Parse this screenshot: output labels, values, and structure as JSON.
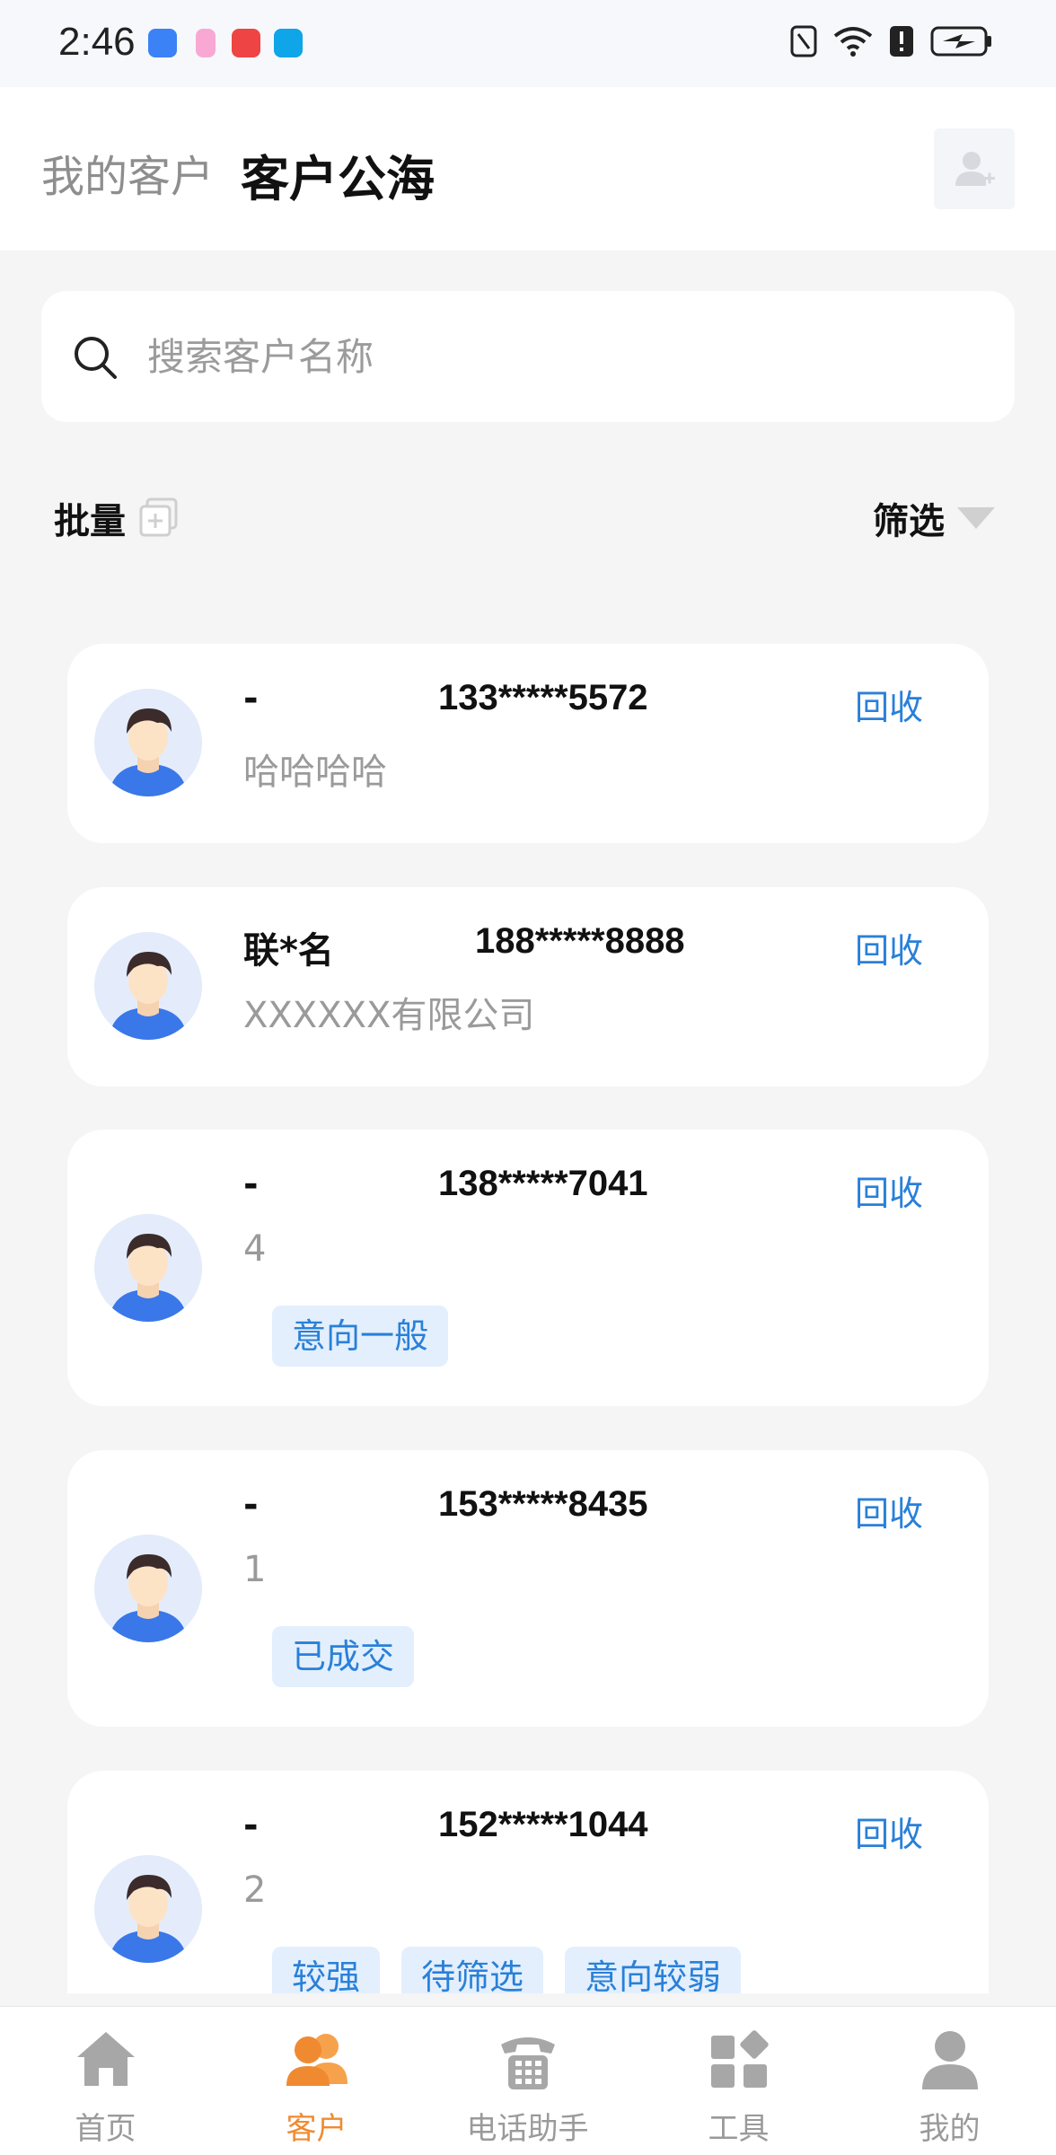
{
  "status_bar": {
    "time": "2:46"
  },
  "header": {
    "tab_mine": "我的客户",
    "tab_public": "客户公海"
  },
  "search": {
    "placeholder": "搜索客户名称"
  },
  "toolbar": {
    "batch_label": "批量",
    "filter_label": "筛选"
  },
  "customers": [
    {
      "name": "-",
      "phone": "133*****5572",
      "action": "回收",
      "sub": "哈哈哈哈",
      "tags": []
    },
    {
      "name": "联*名",
      "phone": "188*****8888",
      "action": "回收",
      "sub": "XXXXXX有限公司",
      "tags": []
    },
    {
      "name": "-",
      "phone": "138*****7041",
      "action": "回收",
      "sub": "4",
      "tags": [
        "意向一般"
      ]
    },
    {
      "name": "-",
      "phone": "153*****8435",
      "action": "回收",
      "sub": "1",
      "tags": [
        "已成交"
      ]
    },
    {
      "name": "-",
      "phone": "152*****1044",
      "action": "回收",
      "sub": "2",
      "tags": [
        "较强",
        "待筛选",
        "意向较弱"
      ]
    }
  ],
  "bottom_nav": {
    "items": [
      {
        "label": "首页",
        "icon": "home-icon"
      },
      {
        "label": "客户",
        "icon": "customers-icon",
        "active": true
      },
      {
        "label": "电话助手",
        "icon": "phone-assistant-icon"
      },
      {
        "label": "工具",
        "icon": "tools-icon"
      },
      {
        "label": "我的",
        "icon": "profile-icon"
      }
    ]
  },
  "colors": {
    "accent": "#2a80d8",
    "nav_active": "#f08a30",
    "tag_bg": "#e3effd"
  }
}
